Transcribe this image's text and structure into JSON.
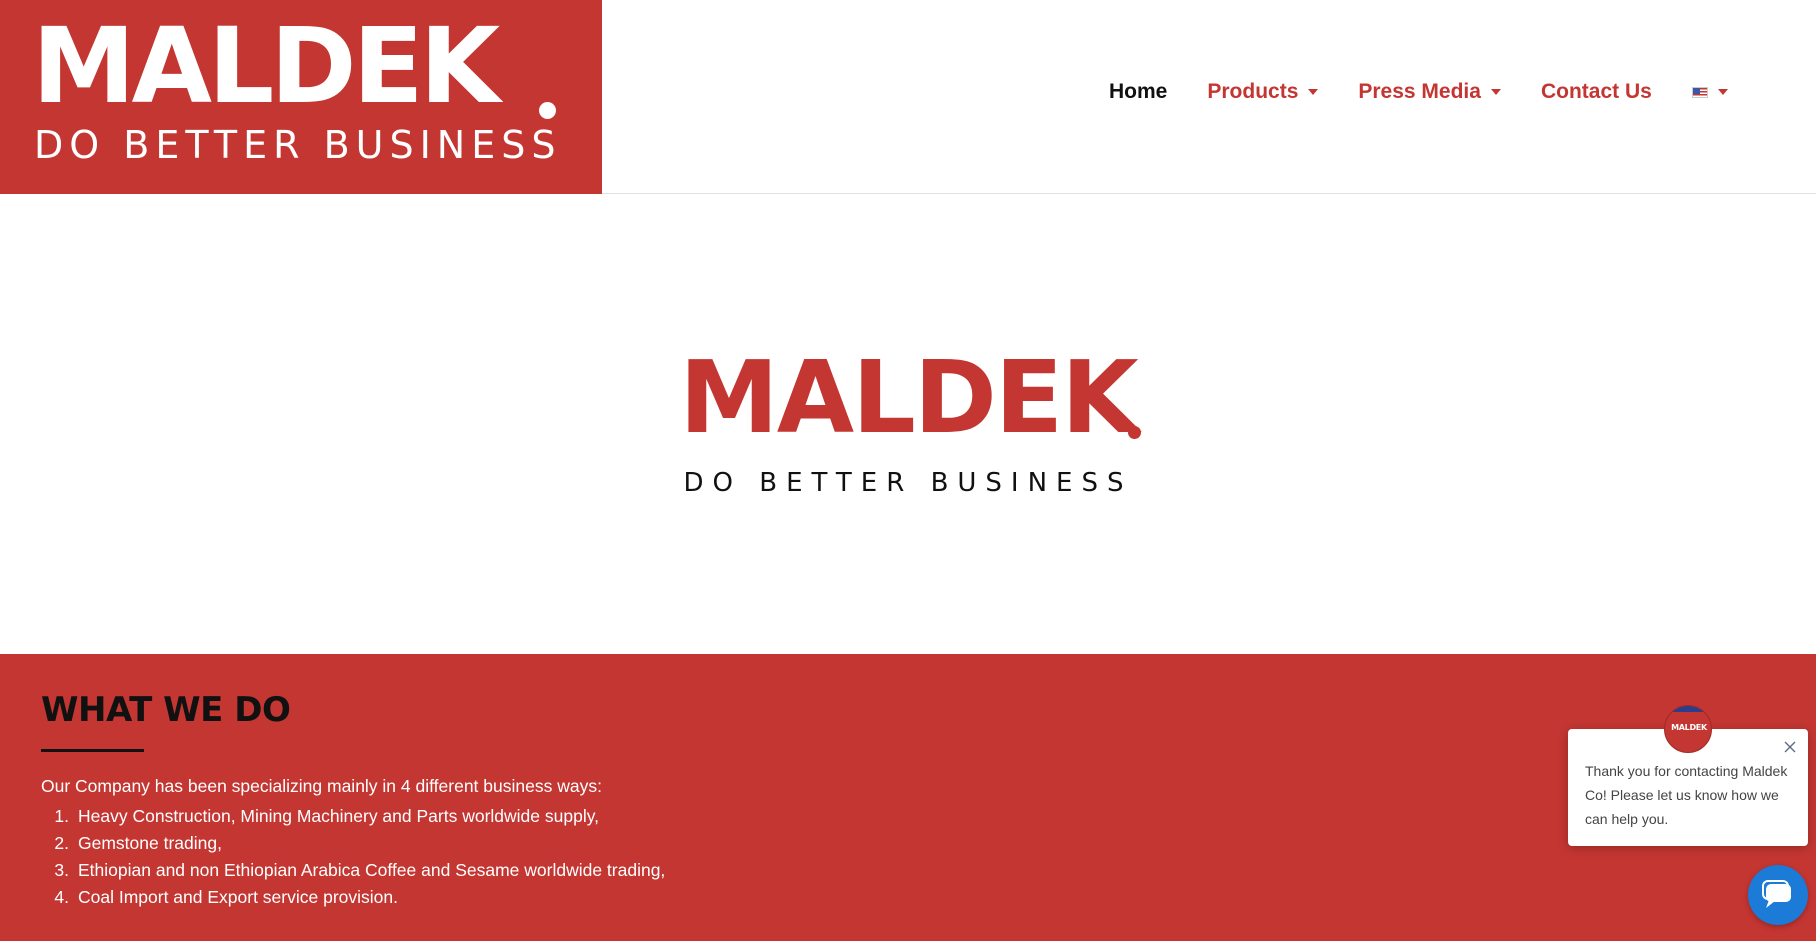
{
  "header": {
    "logo_word": "MALDEK",
    "logo_tagline": "DO BETTER BUSINESS"
  },
  "nav": {
    "items": [
      {
        "label": "Home",
        "dropdown": false
      },
      {
        "label": "Products",
        "dropdown": true
      },
      {
        "label": "Press Media",
        "dropdown": true
      },
      {
        "label": "Contact Us",
        "dropdown": false
      }
    ],
    "language_flag": "us-flag-icon"
  },
  "hero": {
    "title": "MALDEK",
    "tagline": "DO BETTER BUSINESS"
  },
  "what_we_do": {
    "heading": "WHAT WE DO",
    "intro": "Our Company has been specializing mainly in 4 different business ways:",
    "items": [
      {
        "num": "1.",
        "text": "Heavy Construction, Mining Machinery and Parts worldwide supply,"
      },
      {
        "num": "2.",
        "text": "Gemstone trading,"
      },
      {
        "num": "3.",
        "text": "Ethiopian and non Ethiopian Arabica Coffee and Sesame worldwide trading,"
      },
      {
        "num": "4.",
        "text": "Coal Import and Export service provision."
      }
    ]
  },
  "chat": {
    "avatar_label": "MALDEK",
    "message": "Thank you for contacting Maldek Co! Please let us know how we can help you."
  },
  "colors": {
    "brand_red": "#c43632",
    "chat_blue": "#1b7bd6",
    "text_dark": "#111111"
  }
}
